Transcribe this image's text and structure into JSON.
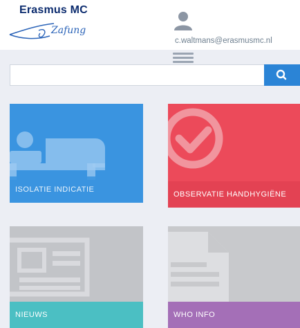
{
  "header": {
    "logo_title": "Erasmus MC",
    "logo_script": "Zafung",
    "user_email": "c.waltmans@erasmusmc.nl"
  },
  "search": {
    "placeholder": "",
    "value": ""
  },
  "icons": {
    "user": "user-icon",
    "menu": "hamburger-menu-icon",
    "search": "search-icon"
  },
  "colors": {
    "brand_blue": "#0b2b6e",
    "search_button": "#2b84d6",
    "tile_isolatie": "#3a94e0",
    "tile_observatie": "#ec4a5a",
    "tile_nieuws_label": "#4bbfc3",
    "tile_who_label": "#a46fb7"
  },
  "tiles": [
    {
      "label": "ISOLATIE INDICATIE",
      "icon": "bed-icon"
    },
    {
      "label": "OBSERVATIE HANDHYGIËNE",
      "icon": "check-circle-icon"
    },
    {
      "label": "NIEUWS",
      "icon": "newspaper-icon"
    },
    {
      "label": "WHO INFO",
      "icon": "document-icon"
    }
  ]
}
